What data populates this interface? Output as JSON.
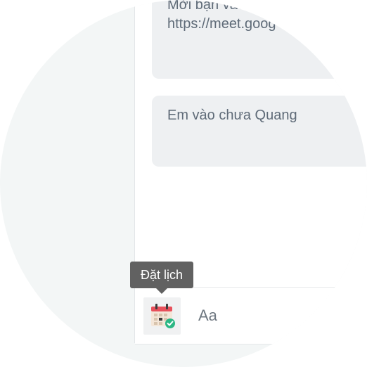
{
  "messages": [
    {
      "line1": "Mời bạn vào",
      "line2": "https://meet.goog"
    },
    {
      "text": "Em vào chưa Quang"
    }
  ],
  "composer": {
    "tooltip": "Đặt lịch",
    "schedule_icon": "calendar-check-icon",
    "placeholder": "Aa"
  },
  "colors": {
    "background_circle": "#f3f6f6",
    "bubble": "#eef0f2",
    "bubble_text": "#5f6b78",
    "tooltip_bg": "#616161",
    "calendar_red": "#e8505b",
    "check_green": "#2bb784"
  }
}
